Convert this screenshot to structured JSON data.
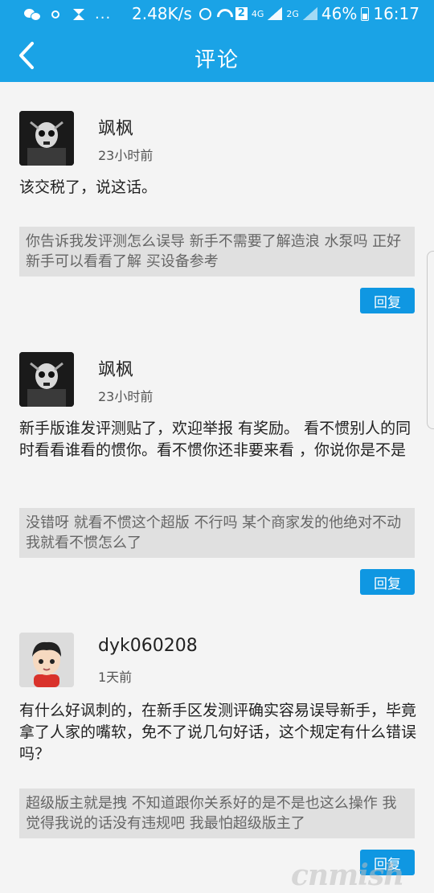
{
  "status_bar": {
    "dots": "...",
    "speed": "2.48K/s",
    "sim_badge": "2",
    "network": "4G",
    "network2": "2G",
    "battery": "46%",
    "time": "16:17"
  },
  "nav": {
    "back_icon": "back-chevron-icon",
    "title": "评论"
  },
  "comments": [
    {
      "author": "飒枫",
      "time": "23小时前",
      "text": "该交税了，说这话。",
      "quote": "你告诉我发评测怎么误导 新手不需要了解造浪 水泵吗 正好新手可以看看了解 买设备参考",
      "reply_label": "回复"
    },
    {
      "author": "飒枫",
      "time": "23小时前",
      "text": "新手版谁发评测贴了，欢迎举报 有奖励。 看不惯别人的同时看看谁看的惯你。看不惯你还非要来看 ，你说你是不是",
      "quote": "没错呀 就看不惯这个超版 不行吗 某个商家发的他绝对不动 我就看不惯怎么了",
      "reply_label": "回复"
    },
    {
      "author": "dyk060208",
      "time": "1天前",
      "text": "有什么好讽刺的，在新手区发测评确实容易误导新手，毕竟拿了人家的嘴软，免不了说几句好话，这个规定有什么错误吗？",
      "quote": "超级版主就是拽 不知道跟你关系好的是不是也这么操作 我觉得我说的话没有违规吧 我最怕超级版主了",
      "reply_label": "回复"
    }
  ],
  "watermark": "cnmish",
  "colors": {
    "accent": "#1aa3e6",
    "reply_button": "#0f97e2",
    "quote_bg": "#e0e0e0"
  }
}
